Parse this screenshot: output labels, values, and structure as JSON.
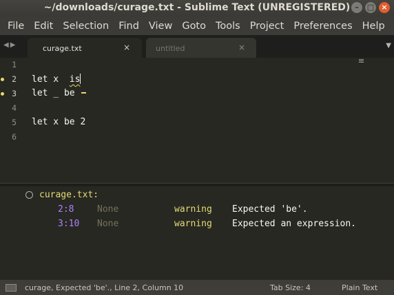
{
  "window": {
    "title": "~/downloads/curage.txt - Sublime Text (UNREGISTERED)"
  },
  "menu": [
    "File",
    "Edit",
    "Selection",
    "Find",
    "View",
    "Goto",
    "Tools",
    "Project",
    "Preferences",
    "Help"
  ],
  "tabs": [
    {
      "label": "curage.txt",
      "close": "×",
      "active": true
    },
    {
      "label": "untitled",
      "close": "×",
      "active": false
    }
  ],
  "editor": {
    "lines": [
      {
        "num": "1",
        "modified": false,
        "pre": "",
        "wavy": "",
        "post": ""
      },
      {
        "num": "2",
        "modified": true,
        "pre": "let x  ",
        "wavy": "is",
        "post": ""
      },
      {
        "num": "3",
        "modified": true,
        "pre": "let _ be ",
        "wavy": "",
        "post": ""
      },
      {
        "num": "4",
        "modified": false,
        "pre": "",
        "wavy": "",
        "post": ""
      },
      {
        "num": "5",
        "modified": false,
        "pre": "let x be 2",
        "wavy": "",
        "post": ""
      },
      {
        "num": "6",
        "modified": false,
        "pre": "",
        "wavy": "",
        "post": ""
      }
    ]
  },
  "panel": {
    "file": "curage.txt:",
    "rows": [
      {
        "pos": "2:8",
        "code": "None",
        "level": "warning",
        "message": "Expected 'be'."
      },
      {
        "pos": "3:10",
        "code": "None",
        "level": "warning",
        "message": "Expected an expression."
      }
    ]
  },
  "status": {
    "text": "curage, Expected 'be'., Line 2, Column 10",
    "tab_size": "Tab Size: 4",
    "syntax": "Plain Text"
  },
  "colors": {
    "accent_yellow": "#e6db74",
    "purple": "#ae81ff",
    "bg": "#272822"
  }
}
